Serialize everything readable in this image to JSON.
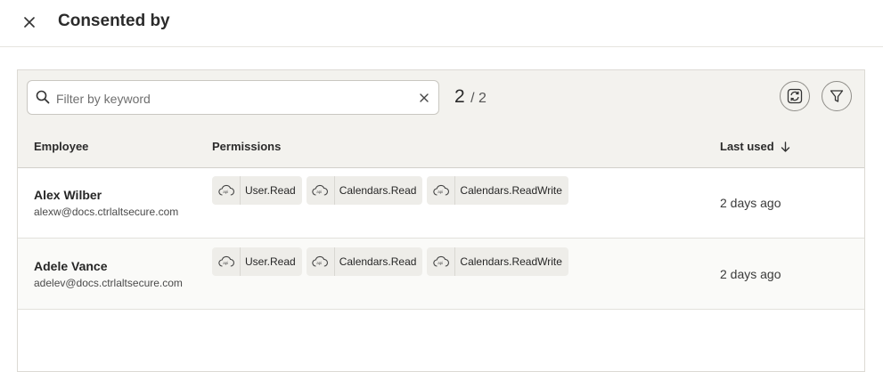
{
  "header": {
    "title": "Consented by"
  },
  "toolbar": {
    "search_placeholder": "Filter by keyword",
    "search_value": "",
    "count_shown": "2",
    "count_total": "/ 2"
  },
  "columns": {
    "employee": "Employee",
    "permissions": "Permissions",
    "last_used": "Last used"
  },
  "rows": [
    {
      "name": "Alex Wilber",
      "email": "alexw@docs.ctrlaltsecure.com",
      "permissions": [
        "User.Read",
        "Calendars.Read",
        "Calendars.ReadWrite"
      ],
      "last_used": "2 days ago"
    },
    {
      "name": "Adele Vance",
      "email": "adelev@docs.ctrlaltsecure.com",
      "permissions": [
        "User.Read",
        "Calendars.Read",
        "Calendars.ReadWrite"
      ],
      "last_used": "2 days ago"
    }
  ],
  "icons": {
    "close": "close-icon",
    "search": "search-icon",
    "clear": "clear-icon",
    "refresh": "refresh-icon",
    "filter": "filter-icon",
    "sort": "arrow-down-icon",
    "permission": "cloud-api-icon"
  }
}
